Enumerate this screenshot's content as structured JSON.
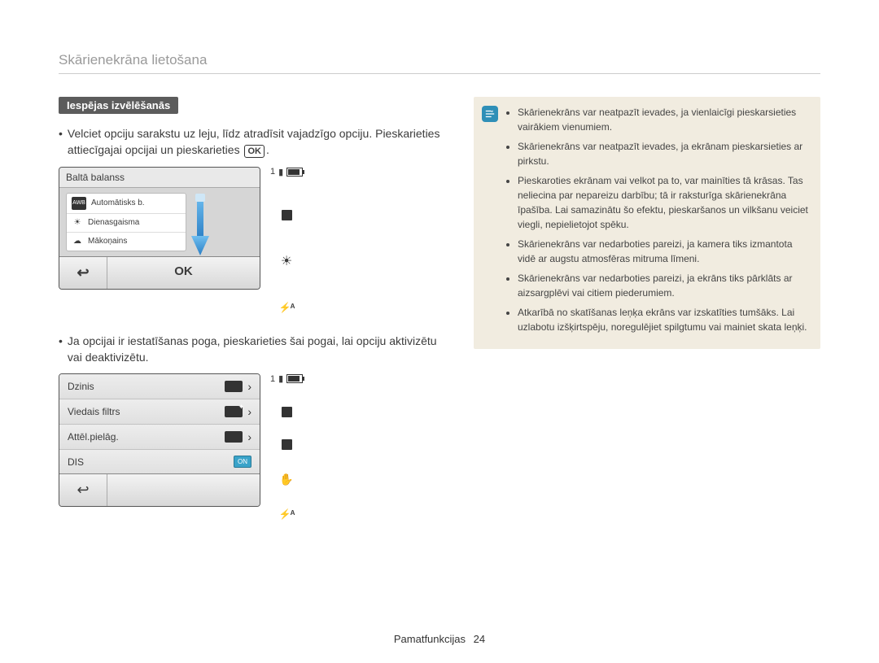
{
  "page": {
    "title": "Skārienekrāna lietošana",
    "section_badge": "Iespējas izvēlēšanās",
    "footer_label": "Pamatfunkcijas",
    "footer_page": "24"
  },
  "left": {
    "p1_a": "Velciet opciju sarakstu uz leju, līdz atradīsit vajadzīgo opciju. Pieskarieties attiecīgajai opcijai un pieskarieties ",
    "p1_b": ".",
    "p2": "Ja opcijai ir iestatīšanas poga, pieskarieties šai pogai, lai opciju aktivizētu vai deaktivizētu."
  },
  "panel1": {
    "header": "Baltā balanss",
    "items": [
      {
        "label": "Automātisks b."
      },
      {
        "label": "Dienasgaisma"
      },
      {
        "label": "Mākoņains"
      }
    ],
    "ok": "OK",
    "side_counter": "1"
  },
  "panel2": {
    "rows": [
      {
        "label": "Dzinis"
      },
      {
        "label": "Viedais filtrs"
      },
      {
        "label": "Attēl.pielāg."
      },
      {
        "label": "DIS"
      }
    ],
    "on": "ON",
    "side_counter": "1"
  },
  "note": {
    "items": [
      "Skārienekrāns var neatpazīt ievades, ja vienlaicīgi pieskarsieties vairākiem vienumiem.",
      "Skārienekrāns var neatpazīt ievades, ja ekrānam pieskarsieties ar pirkstu.",
      "Pieskaroties ekrānam vai velkot pa to, var mainīties tā krāsas. Tas neliecina par nepareizu darbību; tā ir raksturīga skārienekrāna īpašība. Lai samazinātu šo efektu, pieskaršanos un vilkšanu veiciet viegli, nepielietojot spēku.",
      "Skārienekrāns var nedarboties pareizi, ja kamera tiks izmantota vidē ar augstu atmosfēras mitruma līmeni.",
      "Skārienekrāns var nedarboties pareizi, ja ekrāns tiks pārklāts ar aizsargplēvi vai citiem piederumiem.",
      "Atkarībā no skatīšanas leņķa ekrāns var izskatīties tumšāks. Lai uzlabotu izšķirtspēju, noregulējiet spilgtumu vai mainiet skata leņķi."
    ]
  }
}
